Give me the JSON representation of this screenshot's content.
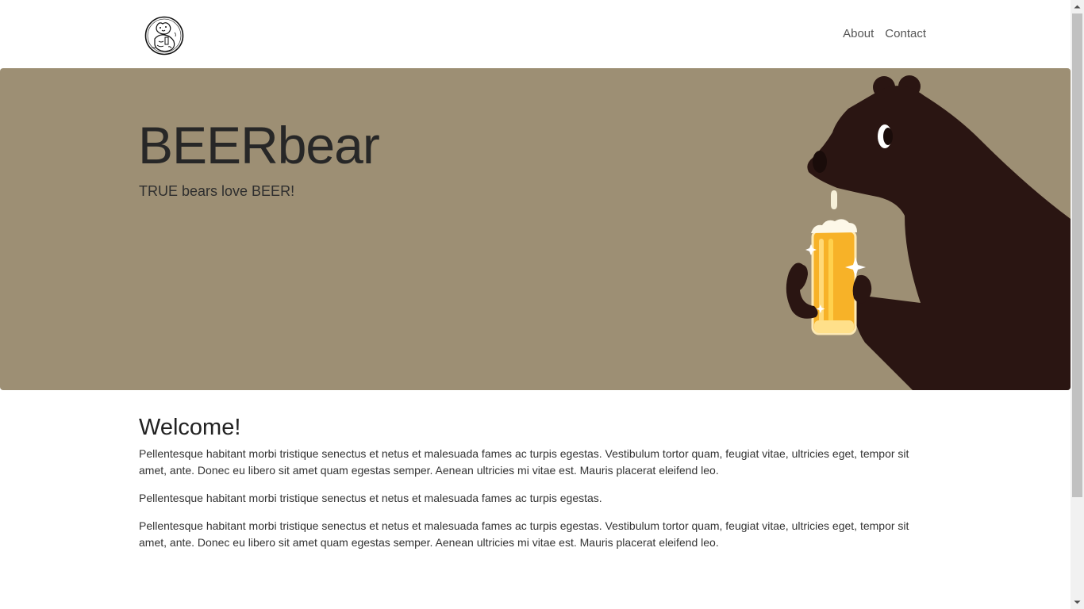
{
  "navbar": {
    "logo_name": "beer-bear-logo",
    "links": [
      {
        "label": "About"
      },
      {
        "label": "Contact"
      }
    ]
  },
  "hero": {
    "title": "BEERbear",
    "tagline": "TRUE bears love BEER!",
    "illustration": "bear-drinking-beer-illustration",
    "background_color": "#9d8f74"
  },
  "main": {
    "heading": "Welcome!",
    "paragraphs": [
      "Pellentesque habitant morbi tristique senectus et netus et malesuada fames ac turpis egestas. Vestibulum tortor quam, feugiat vitae, ultricies eget, tempor sit amet, ante. Donec eu libero sit amet quam egestas semper. Aenean ultricies mi vitae est. Mauris placerat eleifend leo.",
      "Pellentesque habitant morbi tristique senectus et netus et malesuada fames ac turpis egestas.",
      "Pellentesque habitant morbi tristique senectus et netus et malesuada fames ac turpis egestas. Vestibulum tortor quam, feugiat vitae, ultricies eget, tempor sit amet, ante. Donec eu libero sit amet quam egestas semper. Aenean ultricies mi vitae est. Mauris placerat eleifend leo."
    ]
  },
  "colors": {
    "hero_bg": "#9d8f74",
    "bear": "#2a1512",
    "beer": "#f7b228"
  }
}
